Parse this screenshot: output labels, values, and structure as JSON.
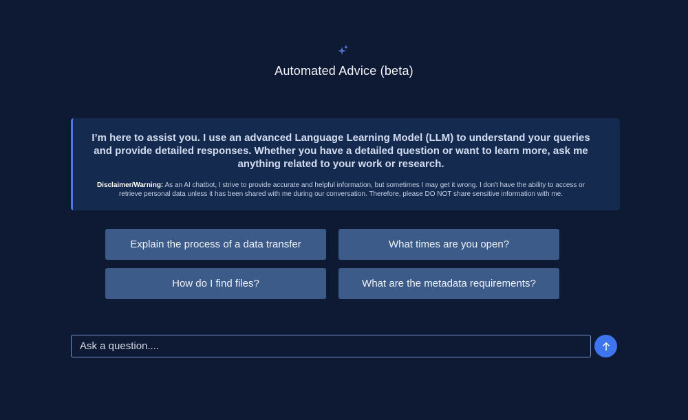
{
  "header": {
    "icon": "sparkle-icon",
    "title": "Automated Advice (beta)"
  },
  "intro": {
    "text": "I’m here to assist you. I use an advanced Language Learning Model (LLM) to understand your queries and provide detailed responses. Whether you have a detailed question or want to learn more, ask me anything related to your work or research.",
    "disclaimer_label": "Disclaimer/Warning:",
    "disclaimer_text": " As an AI chatbot, I strive to provide accurate and helpful information, but sometimes I may get it wrong. I don't have the ability to access or retrieve personal data unless it has been shared with me during our conversation. Therefore, please DO NOT share sensitive information with me."
  },
  "suggestions": [
    {
      "label": "Explain the process of a data transfer"
    },
    {
      "label": "What times are you open?"
    },
    {
      "label": "How do I find files?"
    },
    {
      "label": "What are the metadata requirements?"
    }
  ],
  "chat_input": {
    "placeholder": "Ask a question....",
    "value": "",
    "send_icon": "arrow-up-icon"
  },
  "colors": {
    "background": "#0e1a33",
    "panel": "#142a4e",
    "accent": "#4a78e6",
    "suggestion": "#3d5b89",
    "send_button": "#3e74ee"
  }
}
